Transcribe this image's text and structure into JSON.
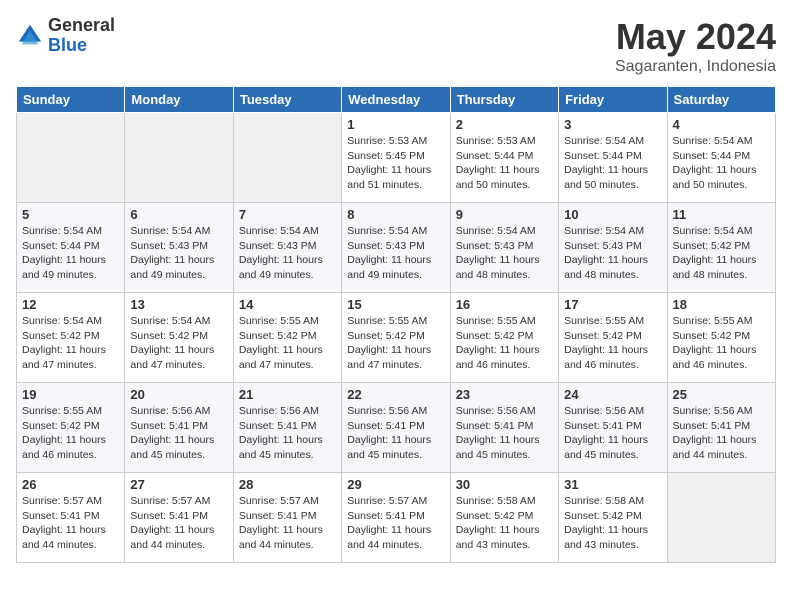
{
  "logo": {
    "general": "General",
    "blue": "Blue"
  },
  "header": {
    "month": "May 2024",
    "location": "Sagaranten, Indonesia"
  },
  "weekdays": [
    "Sunday",
    "Monday",
    "Tuesday",
    "Wednesday",
    "Thursday",
    "Friday",
    "Saturday"
  ],
  "weeks": [
    [
      {
        "day": "",
        "content": ""
      },
      {
        "day": "",
        "content": ""
      },
      {
        "day": "",
        "content": ""
      },
      {
        "day": "1",
        "content": "Sunrise: 5:53 AM\nSunset: 5:45 PM\nDaylight: 11 hours\nand 51 minutes."
      },
      {
        "day": "2",
        "content": "Sunrise: 5:53 AM\nSunset: 5:44 PM\nDaylight: 11 hours\nand 50 minutes."
      },
      {
        "day": "3",
        "content": "Sunrise: 5:54 AM\nSunset: 5:44 PM\nDaylight: 11 hours\nand 50 minutes."
      },
      {
        "day": "4",
        "content": "Sunrise: 5:54 AM\nSunset: 5:44 PM\nDaylight: 11 hours\nand 50 minutes."
      }
    ],
    [
      {
        "day": "5",
        "content": "Sunrise: 5:54 AM\nSunset: 5:44 PM\nDaylight: 11 hours\nand 49 minutes."
      },
      {
        "day": "6",
        "content": "Sunrise: 5:54 AM\nSunset: 5:43 PM\nDaylight: 11 hours\nand 49 minutes."
      },
      {
        "day": "7",
        "content": "Sunrise: 5:54 AM\nSunset: 5:43 PM\nDaylight: 11 hours\nand 49 minutes."
      },
      {
        "day": "8",
        "content": "Sunrise: 5:54 AM\nSunset: 5:43 PM\nDaylight: 11 hours\nand 49 minutes."
      },
      {
        "day": "9",
        "content": "Sunrise: 5:54 AM\nSunset: 5:43 PM\nDaylight: 11 hours\nand 48 minutes."
      },
      {
        "day": "10",
        "content": "Sunrise: 5:54 AM\nSunset: 5:43 PM\nDaylight: 11 hours\nand 48 minutes."
      },
      {
        "day": "11",
        "content": "Sunrise: 5:54 AM\nSunset: 5:42 PM\nDaylight: 11 hours\nand 48 minutes."
      }
    ],
    [
      {
        "day": "12",
        "content": "Sunrise: 5:54 AM\nSunset: 5:42 PM\nDaylight: 11 hours\nand 47 minutes."
      },
      {
        "day": "13",
        "content": "Sunrise: 5:54 AM\nSunset: 5:42 PM\nDaylight: 11 hours\nand 47 minutes."
      },
      {
        "day": "14",
        "content": "Sunrise: 5:55 AM\nSunset: 5:42 PM\nDaylight: 11 hours\nand 47 minutes."
      },
      {
        "day": "15",
        "content": "Sunrise: 5:55 AM\nSunset: 5:42 PM\nDaylight: 11 hours\nand 47 minutes."
      },
      {
        "day": "16",
        "content": "Sunrise: 5:55 AM\nSunset: 5:42 PM\nDaylight: 11 hours\nand 46 minutes."
      },
      {
        "day": "17",
        "content": "Sunrise: 5:55 AM\nSunset: 5:42 PM\nDaylight: 11 hours\nand 46 minutes."
      },
      {
        "day": "18",
        "content": "Sunrise: 5:55 AM\nSunset: 5:42 PM\nDaylight: 11 hours\nand 46 minutes."
      }
    ],
    [
      {
        "day": "19",
        "content": "Sunrise: 5:55 AM\nSunset: 5:42 PM\nDaylight: 11 hours\nand 46 minutes."
      },
      {
        "day": "20",
        "content": "Sunrise: 5:56 AM\nSunset: 5:41 PM\nDaylight: 11 hours\nand 45 minutes."
      },
      {
        "day": "21",
        "content": "Sunrise: 5:56 AM\nSunset: 5:41 PM\nDaylight: 11 hours\nand 45 minutes."
      },
      {
        "day": "22",
        "content": "Sunrise: 5:56 AM\nSunset: 5:41 PM\nDaylight: 11 hours\nand 45 minutes."
      },
      {
        "day": "23",
        "content": "Sunrise: 5:56 AM\nSunset: 5:41 PM\nDaylight: 11 hours\nand 45 minutes."
      },
      {
        "day": "24",
        "content": "Sunrise: 5:56 AM\nSunset: 5:41 PM\nDaylight: 11 hours\nand 45 minutes."
      },
      {
        "day": "25",
        "content": "Sunrise: 5:56 AM\nSunset: 5:41 PM\nDaylight: 11 hours\nand 44 minutes."
      }
    ],
    [
      {
        "day": "26",
        "content": "Sunrise: 5:57 AM\nSunset: 5:41 PM\nDaylight: 11 hours\nand 44 minutes."
      },
      {
        "day": "27",
        "content": "Sunrise: 5:57 AM\nSunset: 5:41 PM\nDaylight: 11 hours\nand 44 minutes."
      },
      {
        "day": "28",
        "content": "Sunrise: 5:57 AM\nSunset: 5:41 PM\nDaylight: 11 hours\nand 44 minutes."
      },
      {
        "day": "29",
        "content": "Sunrise: 5:57 AM\nSunset: 5:41 PM\nDaylight: 11 hours\nand 44 minutes."
      },
      {
        "day": "30",
        "content": "Sunrise: 5:58 AM\nSunset: 5:42 PM\nDaylight: 11 hours\nand 43 minutes."
      },
      {
        "day": "31",
        "content": "Sunrise: 5:58 AM\nSunset: 5:42 PM\nDaylight: 11 hours\nand 43 minutes."
      },
      {
        "day": "",
        "content": ""
      }
    ]
  ]
}
